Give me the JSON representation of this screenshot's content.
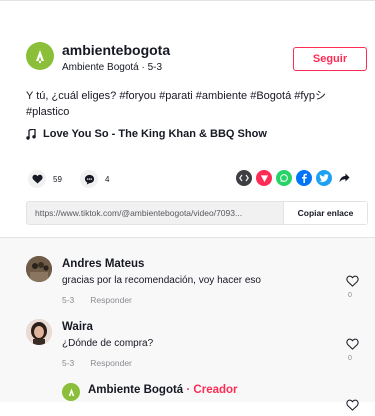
{
  "post": {
    "username": "ambientebogota",
    "display_name": "Ambiente Bogotá",
    "date": "5-3",
    "follow_label": "Seguir",
    "caption_line1": "Y tú, ¿cuál eliges? #foryou #parati #ambiente #Bogotá #fypシ",
    "caption_line2": "#plastico",
    "music": "Love You So - The King Khan & BBQ Show",
    "likes": "59",
    "comments": "4",
    "link": "https://www.tiktok.com/@ambientebogota/video/7093...",
    "copy_label": "Copiar enlace"
  },
  "comments": [
    {
      "name": "Andres Mateus",
      "text": "gracias por la recomendación, voy hacer eso",
      "date": "5-3",
      "reply": "Responder",
      "likes": "0"
    },
    {
      "name": "Waira",
      "text": "¿Dónde de compra?",
      "date": "5-3",
      "reply": "Responder",
      "likes": "0"
    },
    {
      "name": "Ambiente Bogotá",
      "badge": "· Creador"
    }
  ],
  "colors": {
    "accent": "#fe2c55",
    "avatar_green": "#8bbf3a"
  },
  "icons": [
    "like-icon",
    "comment-icon",
    "embed-icon",
    "share-red-icon",
    "whatsapp-icon",
    "facebook-icon",
    "twitter-icon",
    "share-arrow-icon",
    "music-note-icon",
    "heart-outline-icon"
  ]
}
